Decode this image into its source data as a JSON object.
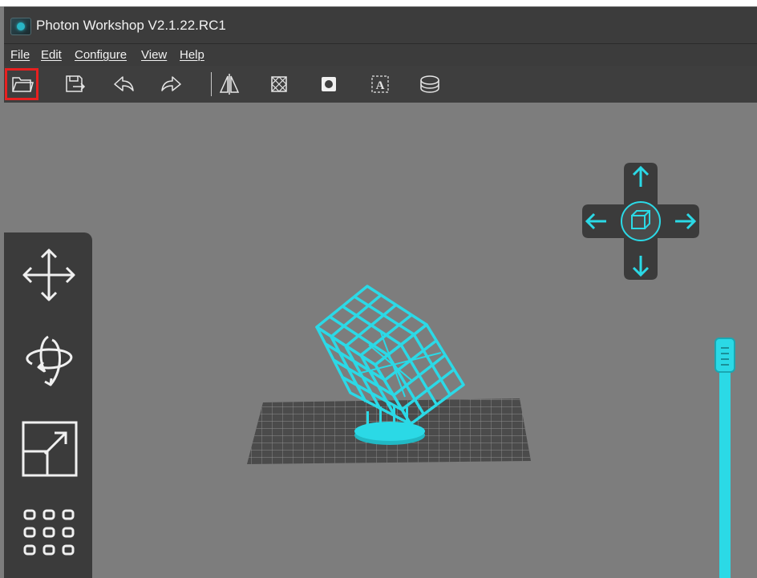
{
  "window": {
    "title": "Photon Workshop V2.1.22.RC1"
  },
  "menu": {
    "items": [
      {
        "label": "File"
      },
      {
        "label": "Edit"
      },
      {
        "label": "Configure"
      },
      {
        "label": "View"
      },
      {
        "label": "Help"
      }
    ]
  },
  "toolbar": {
    "tools": [
      {
        "icon": "open-folder-icon",
        "highlighted": true
      },
      {
        "icon": "save-export-icon"
      },
      {
        "icon": "undo-icon"
      },
      {
        "icon": "redo-icon"
      },
      {
        "icon": "mirror-icon"
      },
      {
        "icon": "hollow-icon"
      },
      {
        "icon": "punch-hole-icon"
      },
      {
        "icon": "text-icon"
      },
      {
        "icon": "cut-icon"
      }
    ]
  },
  "left_tools": [
    {
      "icon": "move-icon"
    },
    {
      "icon": "rotate-icon"
    },
    {
      "icon": "scale-icon"
    },
    {
      "icon": "arrange-grid-icon"
    }
  ],
  "navigation": {
    "buttons": [
      "up-arrow-icon",
      "down-arrow-icon",
      "left-arrow-icon",
      "right-arrow-icon",
      "cube-view-icon"
    ]
  },
  "layer_slider": {
    "position": "top"
  },
  "colors": {
    "accent": "#2bd9e6",
    "titlebar": "#3c3c3c",
    "panel": "#3b3b3b",
    "viewport": "#7d7d7d",
    "highlight": "#e82020"
  }
}
